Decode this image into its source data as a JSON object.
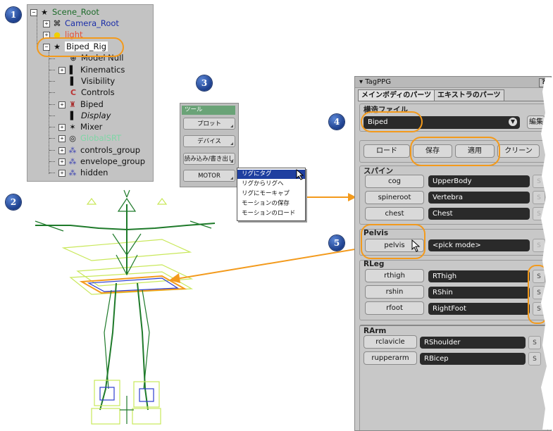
{
  "badges": [
    "1",
    "2",
    "3",
    "4",
    "5"
  ],
  "tree": {
    "items": [
      {
        "label": "Scene_Root",
        "icon": "figure-icon",
        "color": "#1d6b2a"
      },
      {
        "label": "Camera_Root",
        "icon": "camera-icon",
        "color": "#1b2ea8"
      },
      {
        "label": "light",
        "icon": "light-icon",
        "color": "#e4513a"
      },
      {
        "label": "Biped_Rig",
        "icon": "figure-icon",
        "color": "#000000"
      },
      {
        "label": "Model Null",
        "icon": "null-icon",
        "color": "#111111"
      },
      {
        "label": "Kinematics",
        "icon": "kinematics-icon",
        "color": "#111111"
      },
      {
        "label": "Visibility",
        "icon": "visibility-icon",
        "color": "#111111"
      },
      {
        "label": "Controls",
        "icon": "controls-icon",
        "color": "#111111"
      },
      {
        "label": "Biped",
        "icon": "biped-icon",
        "color": "#111111"
      },
      {
        "label": "Display",
        "icon": "display-icon",
        "color": "#111111"
      },
      {
        "label": "Mixer",
        "icon": "mixer-icon",
        "color": "#111111"
      },
      {
        "label": "GlobalSRT",
        "icon": "globalsrt-icon",
        "color": "#7fd6a6"
      },
      {
        "label": "controls_group",
        "icon": "group-icon",
        "color": "#111111"
      },
      {
        "label": "envelope_group",
        "icon": "group-icon",
        "color": "#111111"
      },
      {
        "label": "hidden",
        "icon": "group-icon",
        "color": "#111111"
      }
    ]
  },
  "tools": {
    "header": "ツール",
    "buttons": [
      "プロット",
      "デバイス",
      "読み込み/書き出し",
      "MOTOR"
    ]
  },
  "menu": {
    "items": [
      "リグにタグ",
      "リグからリグへ",
      "リグにモーキャプ",
      "モーションの保存",
      "モーションのロード"
    ]
  },
  "ppg": {
    "title": "TagPPG",
    "help": "?",
    "tabs": [
      "メインボディのパーツ",
      "エキストラのパーツ"
    ],
    "structure_label": "構造ファイル",
    "structure_value": "Biped",
    "edit_button": "編集",
    "actions": [
      "ロード",
      "保存",
      "適用",
      "クリーン"
    ],
    "groups": {
      "spine": {
        "label": "スパイン",
        "rows": [
          {
            "button": "cog",
            "value": "UpperBody"
          },
          {
            "button": "spineroot",
            "value": "Vertebra"
          },
          {
            "button": "chest",
            "value": "Chest"
          }
        ]
      },
      "pelvis": {
        "label": "Pelvis",
        "rows": [
          {
            "button": "pelvis",
            "value": "<pick mode>"
          }
        ]
      },
      "rleg": {
        "label": "RLeg",
        "rows": [
          {
            "button": "rthigh",
            "value": "RThigh"
          },
          {
            "button": "rshin",
            "value": "RShin"
          },
          {
            "button": "rfoot",
            "value": "RightFoot"
          }
        ]
      },
      "rarm": {
        "label": "RArm",
        "rows": [
          {
            "button": "rclavicle",
            "value": "RShoulder"
          },
          {
            "button": "rupperarm",
            "value": "RBicep"
          }
        ]
      }
    },
    "s_label": "S"
  },
  "colors": {
    "highlight": "#f39a1c",
    "arrow": "#f39a1c",
    "rig_green": "#1e7a2a",
    "rig_yellow": "#c9e85a",
    "rig_blue": "#2b3ccf"
  }
}
